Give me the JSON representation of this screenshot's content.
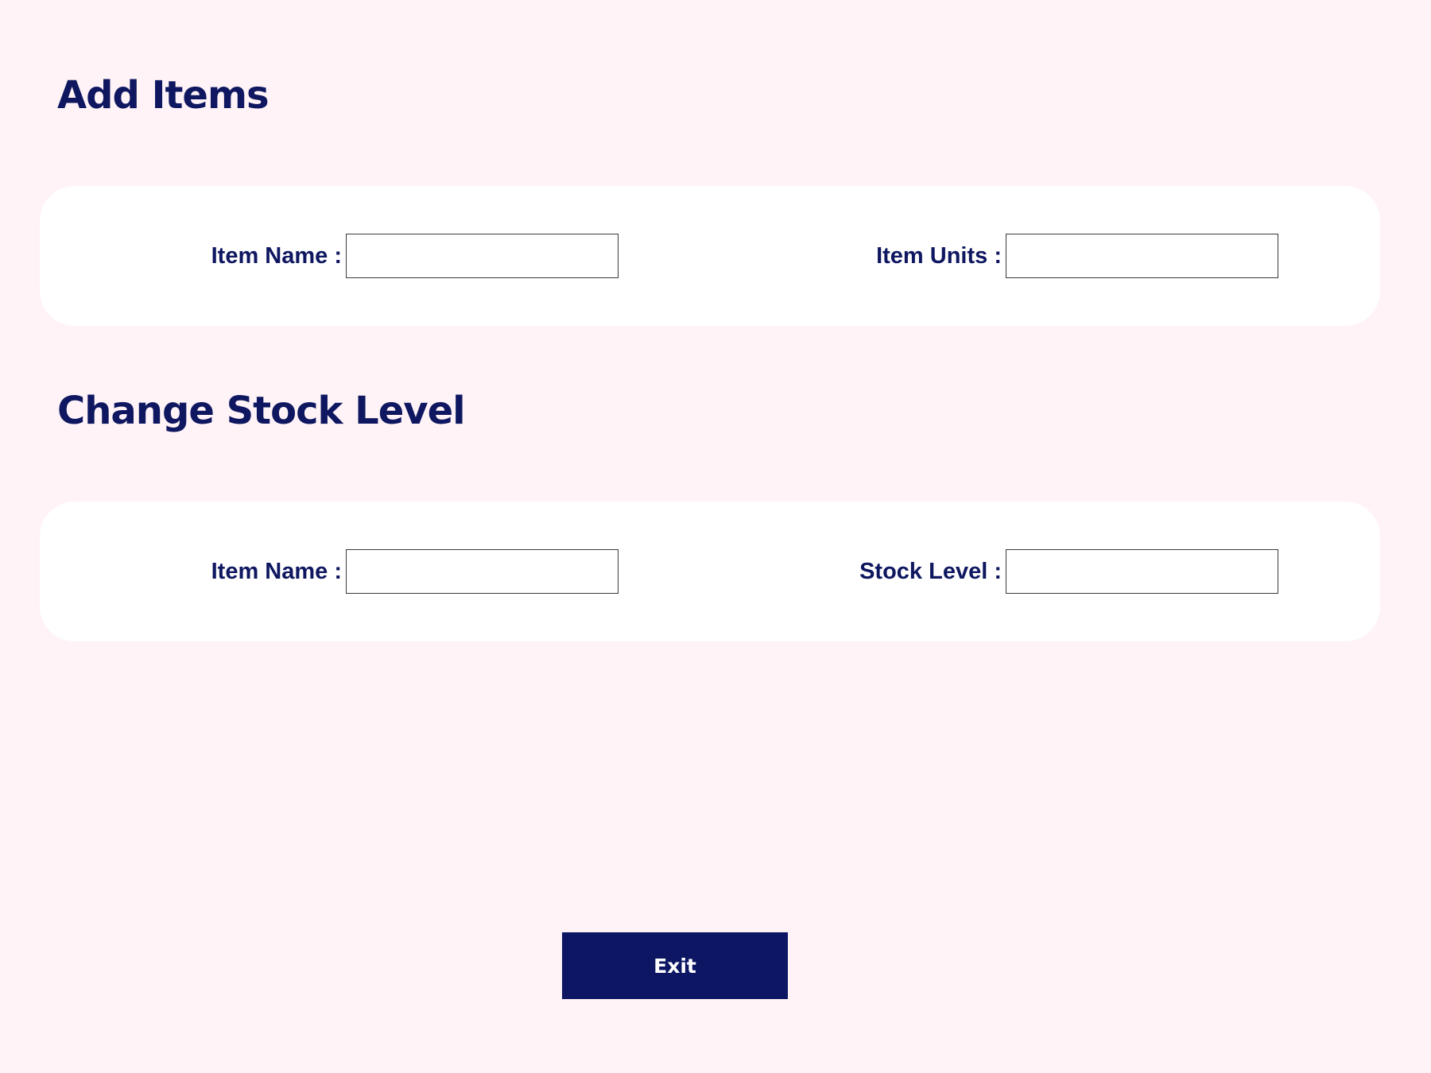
{
  "add_items": {
    "title": "Add Items",
    "item_name_label": "Item Name :",
    "item_name_value": "",
    "item_units_label": "Item Units :",
    "item_units_value": ""
  },
  "change_stock": {
    "title": "Change Stock Level",
    "item_name_label": "Item Name :",
    "item_name_value": "",
    "stock_level_label": "Stock Level :",
    "stock_level_value": ""
  },
  "exit_button": {
    "label": "Exit"
  },
  "colors": {
    "background": "#fff3f7",
    "card": "#ffffff",
    "primary": "#0e1760",
    "button": "#0c1663",
    "button_text": "#ffffff"
  }
}
